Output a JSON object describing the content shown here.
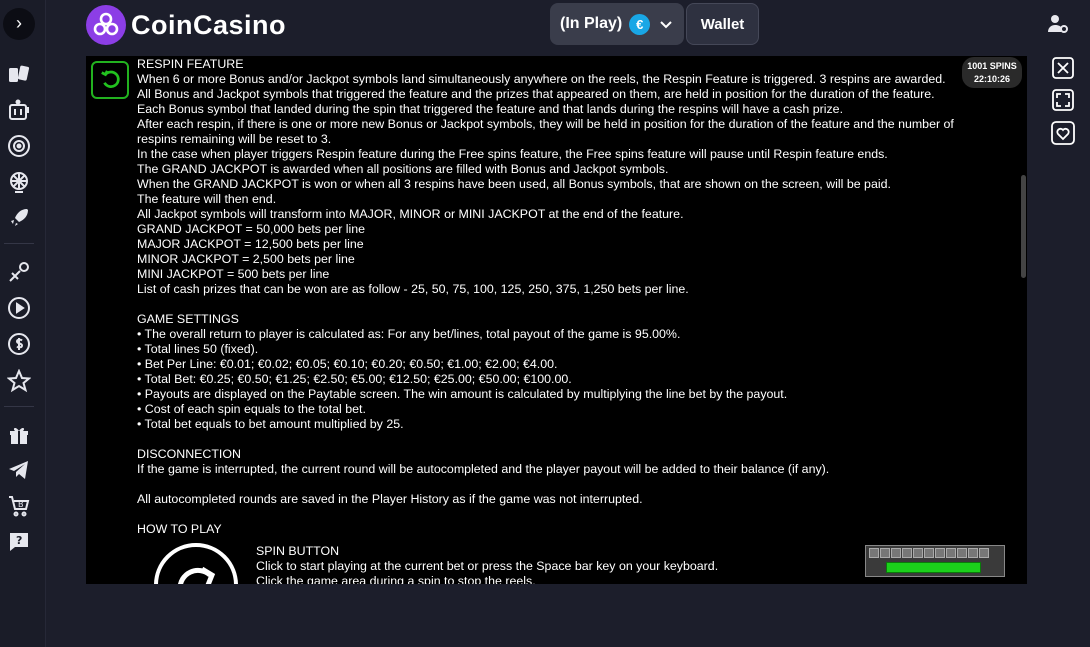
{
  "header": {
    "logo_text": "CoinCasino",
    "inplay_label": "(In Play)",
    "currency_symbol": "€",
    "wallet_label": "Wallet"
  },
  "badge": {
    "spins": "1001 SPINS",
    "time": "22:10:26"
  },
  "colors": {
    "brand_purple": "#8c3ee6",
    "euro_blue": "#19a7e6",
    "back_green": "#22b21f",
    "space_green": "#1bd11b"
  },
  "sidebar_icons": [
    "collapse-chevron-icon",
    "cards-icon",
    "slot-machine-icon",
    "roulette-icon",
    "live-wheel-icon",
    "rocket-icon",
    "sports-icon",
    "play-icon",
    "dollar-coin-icon",
    "star-icon",
    "gift-icon",
    "telegram-icon",
    "bitcoin-cart-icon",
    "support-chat-icon"
  ],
  "content": {
    "lines": [
      "RESPIN FEATURE",
      "When 6 or more Bonus and/or Jackpot symbols land simultaneously anywhere on the reels, the Respin Feature is triggered. 3 respins are awarded.",
      "All Bonus and Jackpot symbols that triggered the feature and the prizes that appeared on them, are held in position for the duration of the feature.",
      "Each Bonus symbol that landed during the spin that triggered the feature and that lands during the respins will have a cash prize.",
      "After each respin, if there is one or more new Bonus or Jackpot symbols, they will be held in position for the duration of the feature and the number of respins remaining will be reset to 3.",
      "In the case when player triggers Respin feature during the Free spins feature, the Free spins feature will pause until Respin feature ends.",
      "The GRAND JACKPOT is awarded when all positions are filled with Bonus and Jackpot symbols.",
      "When the GRAND JACKPOT is won or when all 3 respins have been used, all Bonus symbols, that are shown on the screen, will be paid.",
      "The feature will then end.",
      "All Jackpot symbols will transform into MAJOR, MINOR or MINI JACKPOT at the end of the feature.",
      "GRAND JACKPOT = 50,000 bets per line",
      "MAJOR JACKPOT = 12,500 bets per line",
      "MINOR JACKPOT = 2,500 bets per line",
      "MINI JACKPOT = 500 bets per line",
      "List of cash prizes that can be won are as follow - 25, 50, 75, 100, 125, 250, 375, 1,250 bets per line.",
      "",
      "GAME SETTINGS",
      "• The overall return to player is calculated as: For any bet/lines, total payout of the game is 95.00%.",
      "• Total lines 50 (fixed).",
      "• Bet Per Line:  €0.01; €0.02; €0.05; €0.10; €0.20; €0.50; €1.00; €2.00; €4.00.",
      "• Total Bet:  €0.25; €0.50; €1.25; €2.50; €5.00; €12.50; €25.00; €50.00; €100.00.",
      "• Payouts are displayed on the Paytable screen. The win amount is calculated by multiplying the line bet by the payout.",
      "• Cost of each spin equals to the total bet.",
      "• Total bet equals to bet amount multiplied by 25.",
      "",
      "DISCONNECTION",
      "If the game is interrupted, the current round will be autocompleted and the player payout will be added to their balance (if any).",
      "",
      "All autocompleted rounds are saved in the Player History as if the game was not interrupted.",
      "",
      "HOW TO PLAY"
    ],
    "spin_button": {
      "title": "SPIN BUTTON",
      "line1": "Click to start playing at the current bet or press the Space bar key on your keyboard.",
      "line2": "Click the game area during a spin to stop the reels."
    }
  }
}
